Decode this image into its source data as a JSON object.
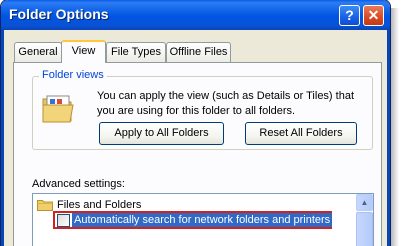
{
  "window": {
    "title": "Folder Options"
  },
  "titlebar": {
    "help_glyph": "?",
    "close_glyph": "✕"
  },
  "tabs": [
    {
      "label": "General"
    },
    {
      "label": "View",
      "active": true
    },
    {
      "label": "File Types"
    },
    {
      "label": "Offline Files"
    }
  ],
  "folder_views": {
    "legend": "Folder views",
    "description": "You can apply the view (such as Details or Tiles) that you are using for this folder to all folders.",
    "apply_label": "Apply to All Folders",
    "reset_label": "Reset All Folders",
    "icon": "folder-views-icon"
  },
  "advanced": {
    "label": "Advanced settings:",
    "items": [
      {
        "type": "folder",
        "label": "Files and Folders",
        "icon": "folder-icon"
      },
      {
        "type": "checkbox",
        "label": "Automatically search for network folders and printers",
        "checked": false,
        "selected": true,
        "highlighted": true
      }
    ]
  },
  "scrollbar": {
    "up_glyph": "▲"
  },
  "colors": {
    "titlebar": "#0054e3",
    "selection": "#316ac5",
    "highlight_outline": "#d32020",
    "group_legend": "#0046d5"
  }
}
